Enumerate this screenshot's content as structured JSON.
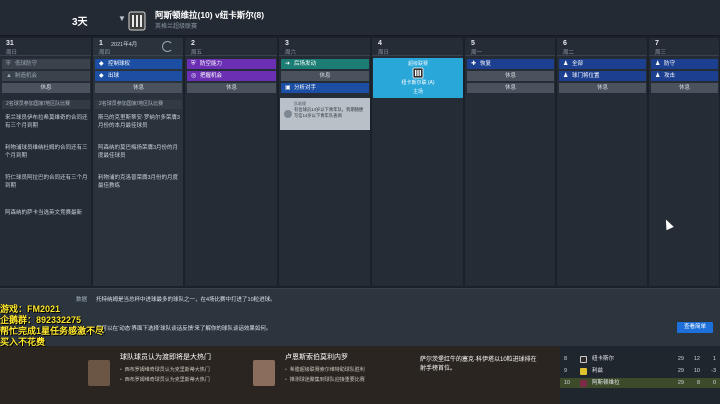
{
  "header": {
    "days_left": "3天",
    "match_title": "阿斯顿维拉(10) v纽卡斯尔(8)",
    "match_subtitle": "英格兰超级联赛"
  },
  "calendar": {
    "days": [
      {
        "num": "31",
        "month": "",
        "weekday": "周日"
      },
      {
        "num": "1",
        "month": "2021年4月",
        "weekday": "周四"
      },
      {
        "num": "2",
        "month": "",
        "weekday": "周五"
      },
      {
        "num": "3",
        "month": "",
        "weekday": "周六"
      },
      {
        "num": "4",
        "month": "",
        "weekday": "周日"
      },
      {
        "num": "5",
        "month": "",
        "weekday": "周一"
      },
      {
        "num": "6",
        "month": "",
        "weekday": "周二"
      },
      {
        "num": "7",
        "month": "",
        "weekday": "周三"
      }
    ],
    "slots": {
      "d0": [
        "低球防守",
        "制造机会",
        "休息"
      ],
      "d1": [
        "控制球权",
        "出球",
        "休息"
      ],
      "d2": [
        "防空能力",
        "把握机会",
        "休息"
      ],
      "d3": [
        "后场发动",
        "休息",
        "分析对手"
      ],
      "d5": [
        "恢复",
        "休息",
        "休息"
      ],
      "d6": [
        "全部",
        "球门将位置",
        "休息"
      ],
      "d7": [
        "防守",
        "攻击",
        "休息"
      ]
    },
    "match_card": {
      "title": "超级联赛",
      "team": "纽卡斯尔联 (A)",
      "venue": "主场"
    },
    "notes": {
      "d0_header": "2名球员参加国家/地区队比赛",
      "d0_items": [
        "来兰球员伊布拉希莫维奇的合同还有三个月到期",
        "利物浦球员维纳杜姆的合同还有三个月到期",
        "符仁球员阿拉巴的合同还有三个月到期",
        "阿森纳的萨卡当选英文竞赛最新"
      ],
      "d1_header": "2名球员参加国家/地区队比赛",
      "d1_items": [
        "斯马的克里斯蒂安·罗纳尔多荣膺3月份的本月最佳球员",
        "阿森纳的莫巴梅扬荣膺3月份的月度最佳球员",
        "利物浦的克洛普荣膺3月份的月度最佳教练"
      ]
    },
    "news_card": {
      "from": "队助理",
      "text": "有位球员14岁以下青年队，到期随便写信14岁以下青年队查阅"
    }
  },
  "bottom": {
    "label": "数据",
    "text1": "托特纳姆是当总杯中进球最多的球队之一，在4场比赛中打进了10粒进球。",
    "text2": "您可以在‘动态’界面下选择‘球队谈话反馈’来了解你的球队谈话效果如何。",
    "button": "查看简单"
  },
  "overlay": {
    "line1_label": "游戏：",
    "line1_value": "FM2021",
    "line2_label": "企鹅群：",
    "line2_value": "892332275",
    "line3": "帮忙完成1星任务感激不尽",
    "line4": "买入不花费"
  },
  "news_strip": {
    "block1_title": "球队球员认为渡即将是大热门",
    "block1_items": [
      "西布罗姆维奇球员认为克里斯蒂大热门",
      "西布罗姆维奇球员认为克里斯蒂大热门"
    ],
    "block2_title": "卢恩斯索伯莫利内罗",
    "block2_items": [
      "希腊超级联赛索尔维特助球队胜利",
      "推测球迷聚集到球队迎接重要比赛"
    ],
    "headline": "萨尔茨堡红牛的塞克·科伊塔以10粒进球排在射手榜首位。"
  },
  "league": {
    "rows": [
      {
        "pos": "8",
        "club": "纽卡斯尔",
        "p": "29",
        "d": "12",
        "w": "1",
        "crest": "#2b2b2b"
      },
      {
        "pos": "9",
        "club": "利兹",
        "p": "29",
        "d": "10",
        "w": "-3",
        "crest": "#e0c32e"
      },
      {
        "pos": "10",
        "club": "阿斯顿维拉",
        "p": "29",
        "d": "8",
        "w": "0",
        "crest": "#7d2a45"
      }
    ]
  }
}
